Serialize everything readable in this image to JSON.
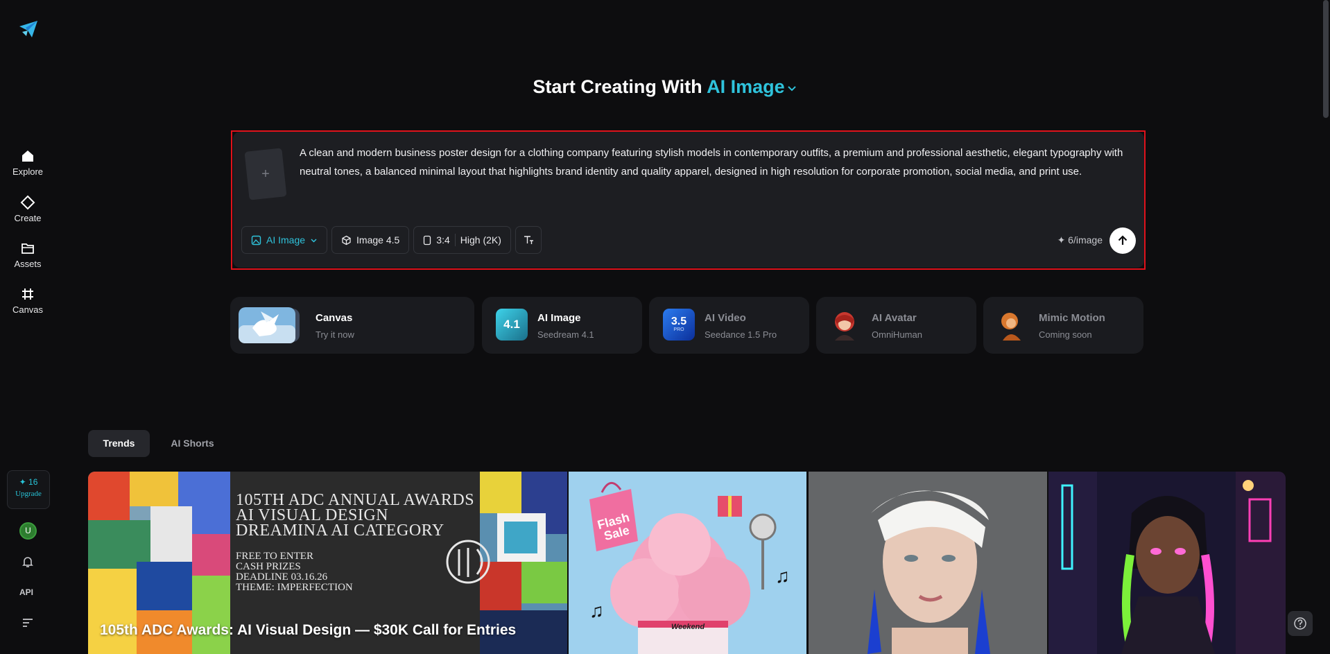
{
  "sidebar": {
    "items": [
      {
        "label": "Explore",
        "icon": "home-icon"
      },
      {
        "label": "Create",
        "icon": "diamond-icon"
      },
      {
        "label": "Assets",
        "icon": "folder-icon"
      },
      {
        "label": "Canvas",
        "icon": "frame-icon"
      }
    ],
    "credits": "✦ 16",
    "upgrade_label": "Upgrade",
    "avatar_initial": "U",
    "api_label": "API"
  },
  "header": {
    "title_prefix": "Start Creating With",
    "title_accent": "AI Image"
  },
  "prompt": {
    "text": "A clean and modern business poster design for a clothing company featuring stylish models in contemporary outfits, a premium and professional aesthetic, elegant typography with neutral tones, a balanced minimal layout that highlights brand identity and quality apparel, designed in high resolution for corporate promotion, social media, and print use.",
    "add_reference_glyph": "+",
    "mode_label": "AI Image",
    "model_label": "Image 4.5",
    "ratio_label": "3:4",
    "quality_label": "High (2K)",
    "cost_label": "✦ 6/image"
  },
  "model_cards": [
    {
      "name": "Canvas",
      "sub": "Try it now"
    },
    {
      "name": "AI Image",
      "sub": "Seedream 4.1",
      "badge": "4.1"
    },
    {
      "name": "AI Video",
      "sub": "Seedance 1.5 Pro",
      "badge": "3.5",
      "badge_sub": "PRO"
    },
    {
      "name": "AI Avatar",
      "sub": "OmniHuman"
    },
    {
      "name": "Mimic Motion",
      "sub": "Coming soon"
    }
  ],
  "tabs": [
    {
      "label": "Trends",
      "active": true
    },
    {
      "label": "AI Shorts",
      "active": false
    }
  ],
  "gallery": {
    "feature_caption": "105th ADC Awards: AI Visual Design — $30K Call for Entries",
    "poster_lines": [
      "105TH ADC ANNUAL AWARDS",
      "AI VISUAL DESIGN",
      "DREAMINA AI CATEGORY"
    ],
    "poster_small_lines": [
      "FREE TO ENTER",
      "CASH PRIZES",
      "DEADLINE 03.16.26",
      "THEME: IMPERFECTION"
    ],
    "flash_sale_text": "Flash Sale",
    "weekend_text": "Weekend"
  },
  "colors": {
    "accent": "#2fc3dc",
    "background": "#0d0d0f",
    "highlight_border": "#e0121b"
  }
}
